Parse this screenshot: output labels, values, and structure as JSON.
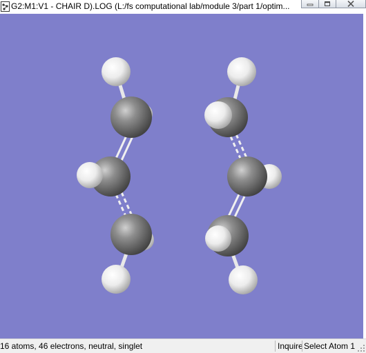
{
  "window": {
    "title": "G2:M1:V1 - CHAIR D).LOG (L:/fs computational lab/module 3/part 1/optim..."
  },
  "icons": {
    "app": "gaussview-document-icon",
    "minimize": "minimize-icon",
    "maximize": "maximize-icon",
    "close": "close-icon",
    "grip": "resize-grip-icon"
  },
  "colors": {
    "viewport_background": "#7f7fcb",
    "carbon_atom": "#8c8c8c",
    "hydrogen_atom": "#f2f2f2",
    "bond": "#e6e6e6"
  },
  "molecule": {
    "atom_count": 16,
    "carbon_count": 6,
    "hydrogen_count": 10
  },
  "statusbar": {
    "summary": "16 atoms, 46 electrons, neutral, singlet",
    "mode": "Inquire",
    "selection": "Select Atom 1"
  }
}
